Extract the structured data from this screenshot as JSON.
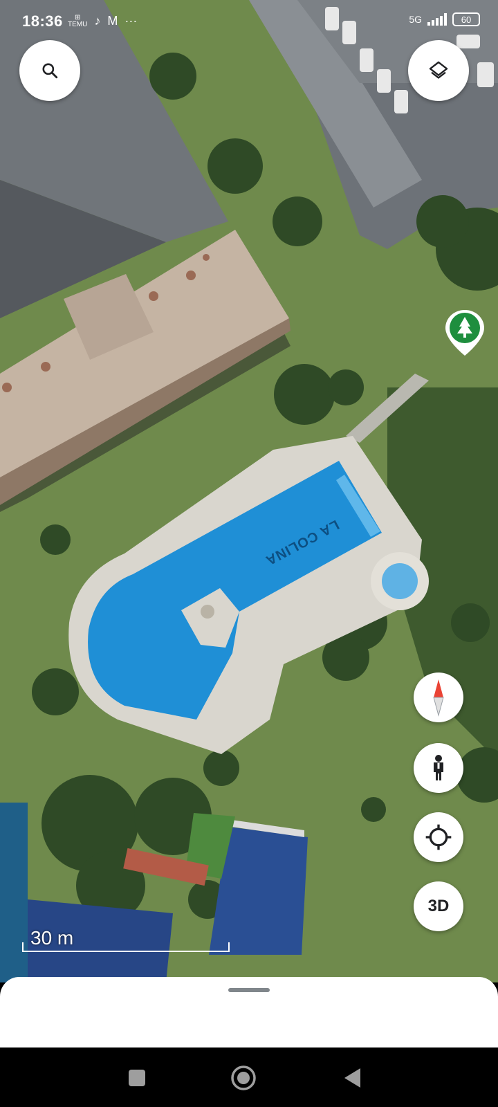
{
  "status_bar": {
    "time": "18:36",
    "notifications": [
      "TEMU",
      "TikTok",
      "Gmail",
      "more"
    ],
    "more_label": "···",
    "network": "5G",
    "battery": "60"
  },
  "map": {
    "pool_text": "LA COLINA",
    "scale_label": "30 m",
    "place_pin": "park-pin-icon"
  },
  "buttons": {
    "search": "search-icon",
    "layers": "layers-icon",
    "compass": "compass-icon",
    "street_view": "pegman-icon",
    "my_location": "my-location-icon",
    "three_d_label": "3D"
  },
  "colors": {
    "pool_water": "#1f8fd6",
    "grass": "#6e8b4a",
    "roof": "#c9b9a8",
    "pin_green": "#1e8e3e",
    "compass_red": "#ea4335"
  }
}
